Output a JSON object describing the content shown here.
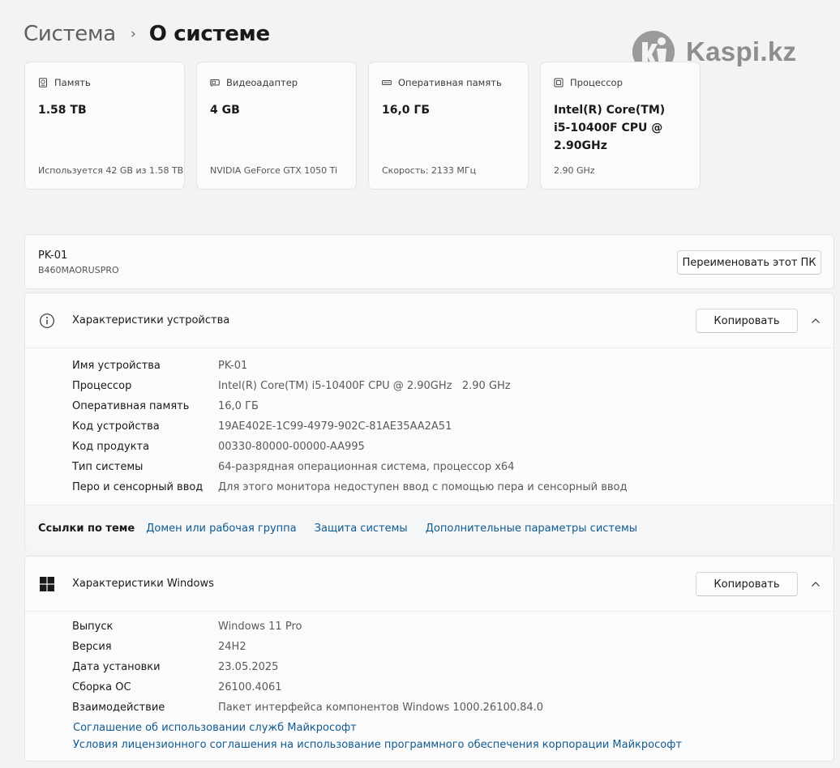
{
  "header": {
    "parent": "Система",
    "separator": "›",
    "current": "О системе"
  },
  "watermark": {
    "text": "Kaspi.kz"
  },
  "cards": [
    {
      "icon": "storage-icon",
      "title": "Память",
      "value": "1.58 TB",
      "sub": "Используется 42 GB из 1.58 TB"
    },
    {
      "icon": "gpu-icon",
      "title": "Видеоадаптер",
      "value": "4 GB",
      "sub": "NVIDIA GeForce GTX 1050 Ti"
    },
    {
      "icon": "ram-icon",
      "title": "Оперативная память",
      "value": "16,0 ГБ",
      "sub": "Скорость: 2133 МГц"
    },
    {
      "icon": "cpu-icon",
      "title": "Процессор",
      "value_lines": [
        "Intel(R) Core(TM)",
        "i5-10400F CPU @",
        "2.90GHz"
      ],
      "sub": "2.90 GHz"
    }
  ],
  "pc": {
    "name": "PK-01",
    "model": "B460MAORUSPRO",
    "rename_label": "Переименовать этот ПК"
  },
  "device_specs": {
    "title": "Характеристики устройства",
    "copy_label": "Копировать",
    "rows": [
      {
        "label": "Имя устройства",
        "value": "PK-01"
      },
      {
        "label": "Процессор",
        "value": "Intel(R) Core(TM) i5-10400F CPU @ 2.90GHz   2.90 GHz"
      },
      {
        "label": "Оперативная память",
        "value": "16,0 ГБ"
      },
      {
        "label": "Код устройства",
        "value": "19AE402E-1C99-4979-902C-81AE35AA2A51"
      },
      {
        "label": "Код продукта",
        "value": "00330-80000-00000-AA995"
      },
      {
        "label": "Тип системы",
        "value": "64-разрядная операционная система, процессор x64"
      },
      {
        "label": "Перо и сенсорный ввод",
        "value": "Для этого монитора недоступен ввод с помощью пера и сенсорный ввод"
      }
    ]
  },
  "related_links": {
    "title": "Ссылки по теме",
    "links": [
      "Домен или рабочая группа",
      "Защита системы",
      "Дополнительные параметры системы"
    ]
  },
  "windows_specs": {
    "title": "Характеристики Windows",
    "copy_label": "Копировать",
    "rows": [
      {
        "label": "Выпуск",
        "value": "Windows 11 Pro"
      },
      {
        "label": "Версия",
        "value": "24H2"
      },
      {
        "label": "Дата установки",
        "value": "23.05.2025"
      },
      {
        "label": "Сборка ОС",
        "value": "26100.4061"
      },
      {
        "label": "Взаимодействие",
        "value": "Пакет интерфейса компонентов Windows 1000.26100.84.0"
      }
    ],
    "links": [
      "Соглашение об использовании служб Майкрософт",
      "Условия лицензионного соглашения на использование программного обеспечения корпорации Майкрософт"
    ]
  }
}
